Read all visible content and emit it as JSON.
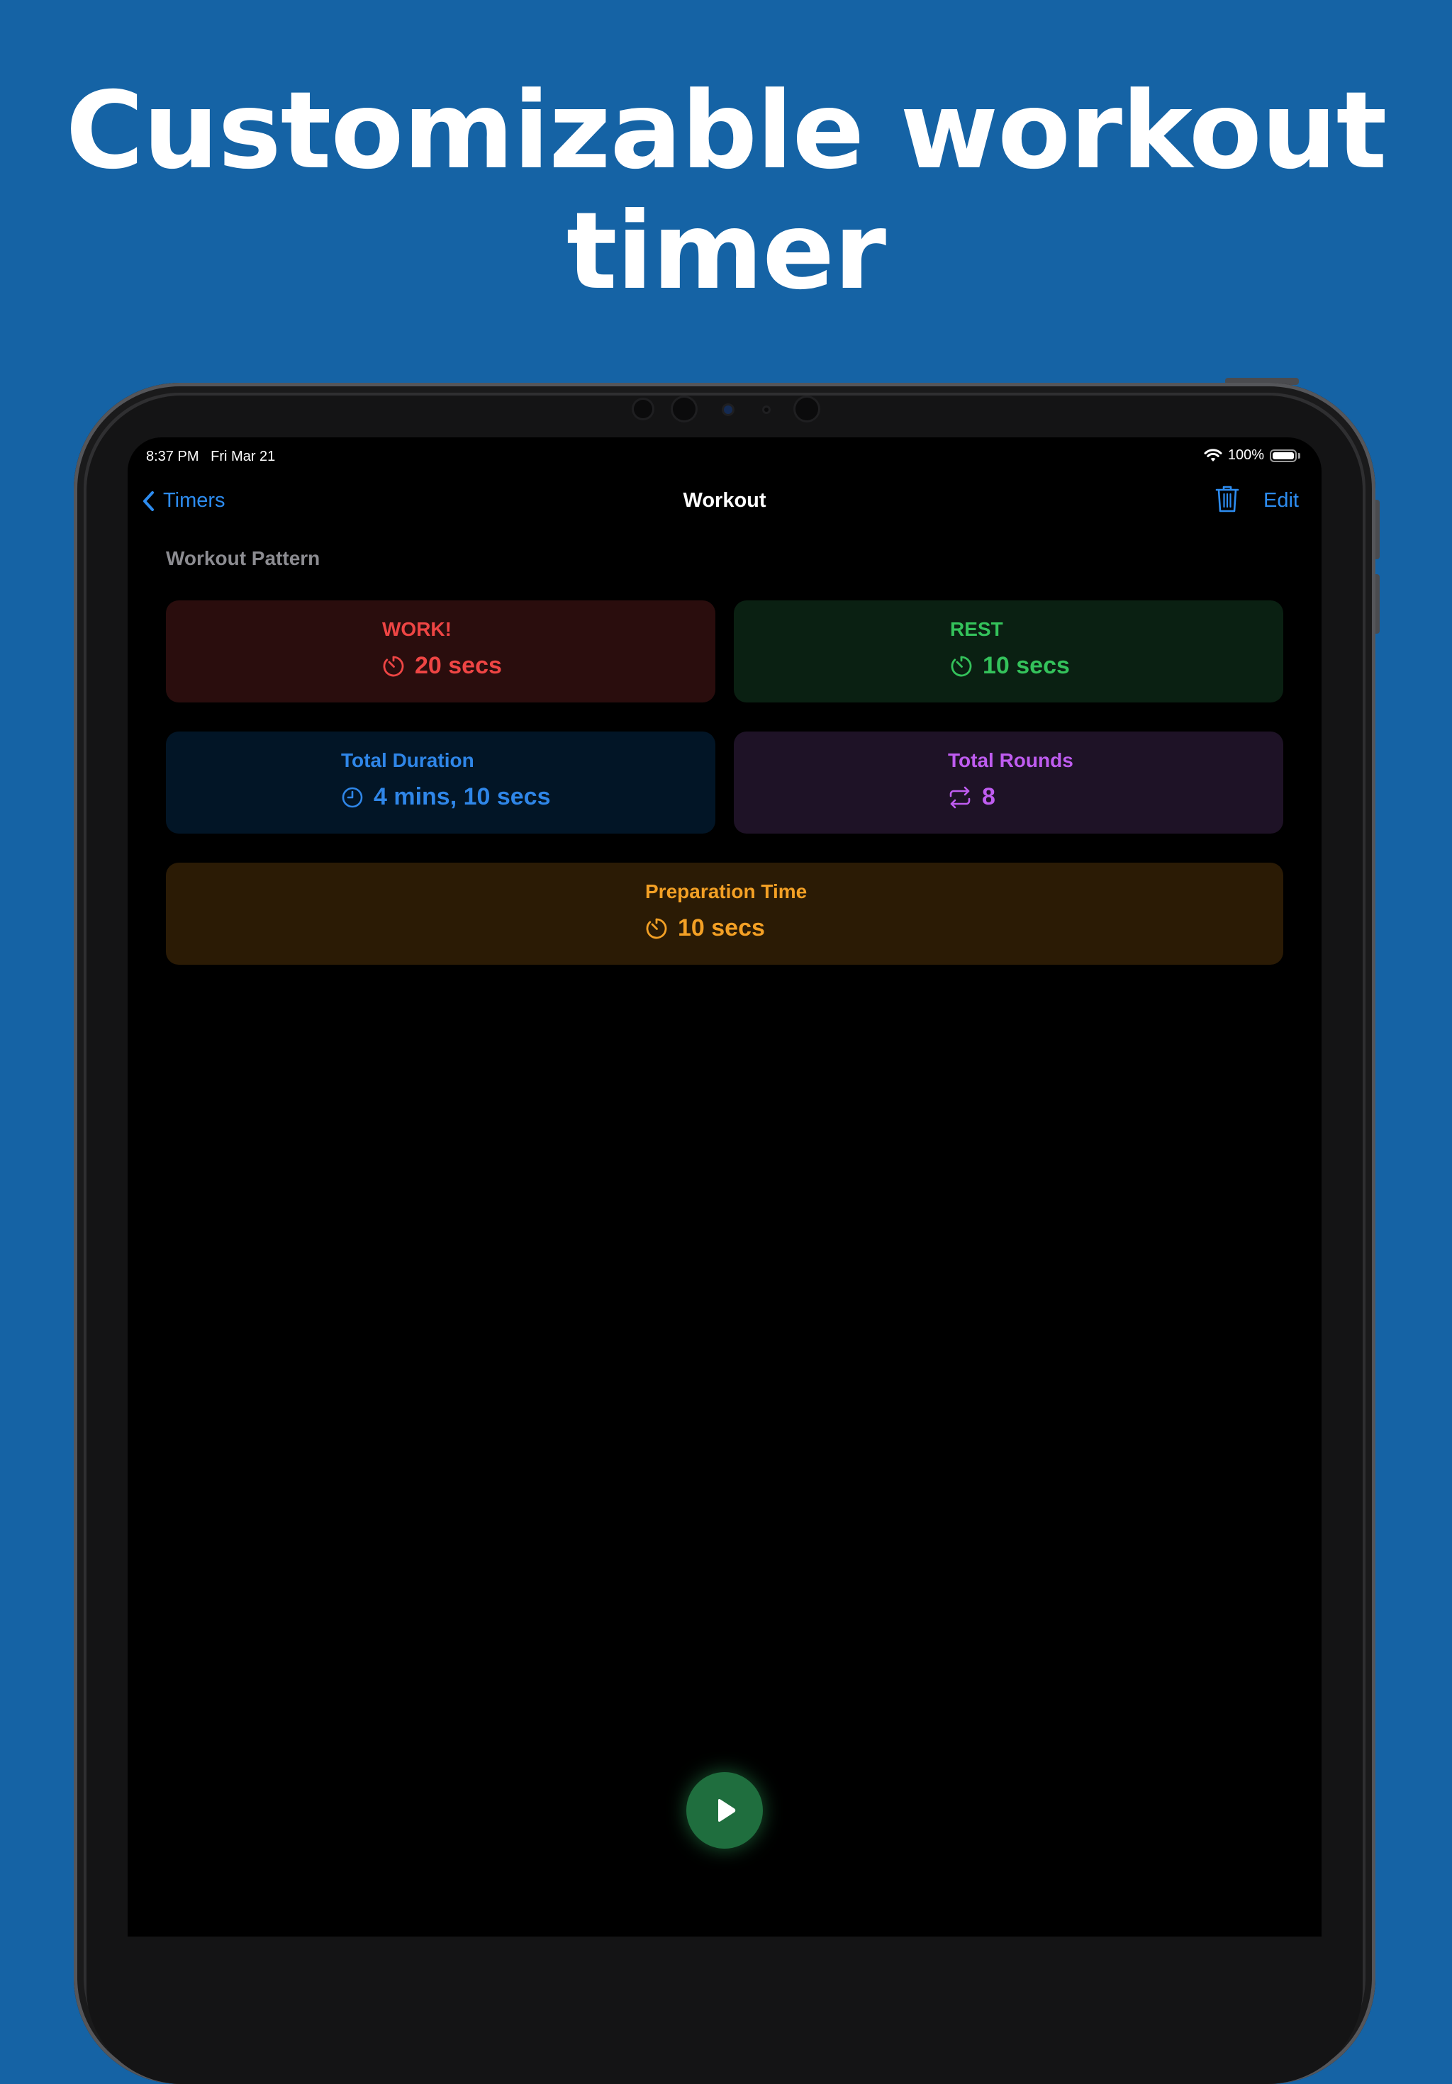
{
  "headline": {
    "line1": "Customizable workout",
    "line2": "timer"
  },
  "status_bar": {
    "time": "8:37 PM   Fri Mar 21",
    "battery": "100%",
    "battery_level": 1.0
  },
  "nav": {
    "back_label": "Timers",
    "title": "Workout",
    "edit_label": "Edit"
  },
  "section_label": "Workout Pattern",
  "cards": [
    {
      "label": "WORK!",
      "value": "20 secs",
      "icon": "timer-icon",
      "color": "#ee4544",
      "bg": "#2a0d0d"
    },
    {
      "label": "REST",
      "value": "10 secs",
      "icon": "timer-icon",
      "color": "#34c25b",
      "bg": "#0a2012"
    },
    {
      "label": "Total Duration",
      "value": "4 mins, 10 secs",
      "icon": "clock-icon",
      "color": "#2f86e8",
      "bg": "#021526"
    },
    {
      "label": "Total Rounds",
      "value": "8",
      "icon": "repeat-icon",
      "color": "#bf5cf0",
      "bg": "#1e1226"
    },
    {
      "label": "Preparation Time",
      "value": "10 secs",
      "icon": "timer-icon",
      "color": "#f3a025",
      "bg": "#2b1b05"
    }
  ],
  "play_icon": "play-icon",
  "accent": "#2d8cf0"
}
